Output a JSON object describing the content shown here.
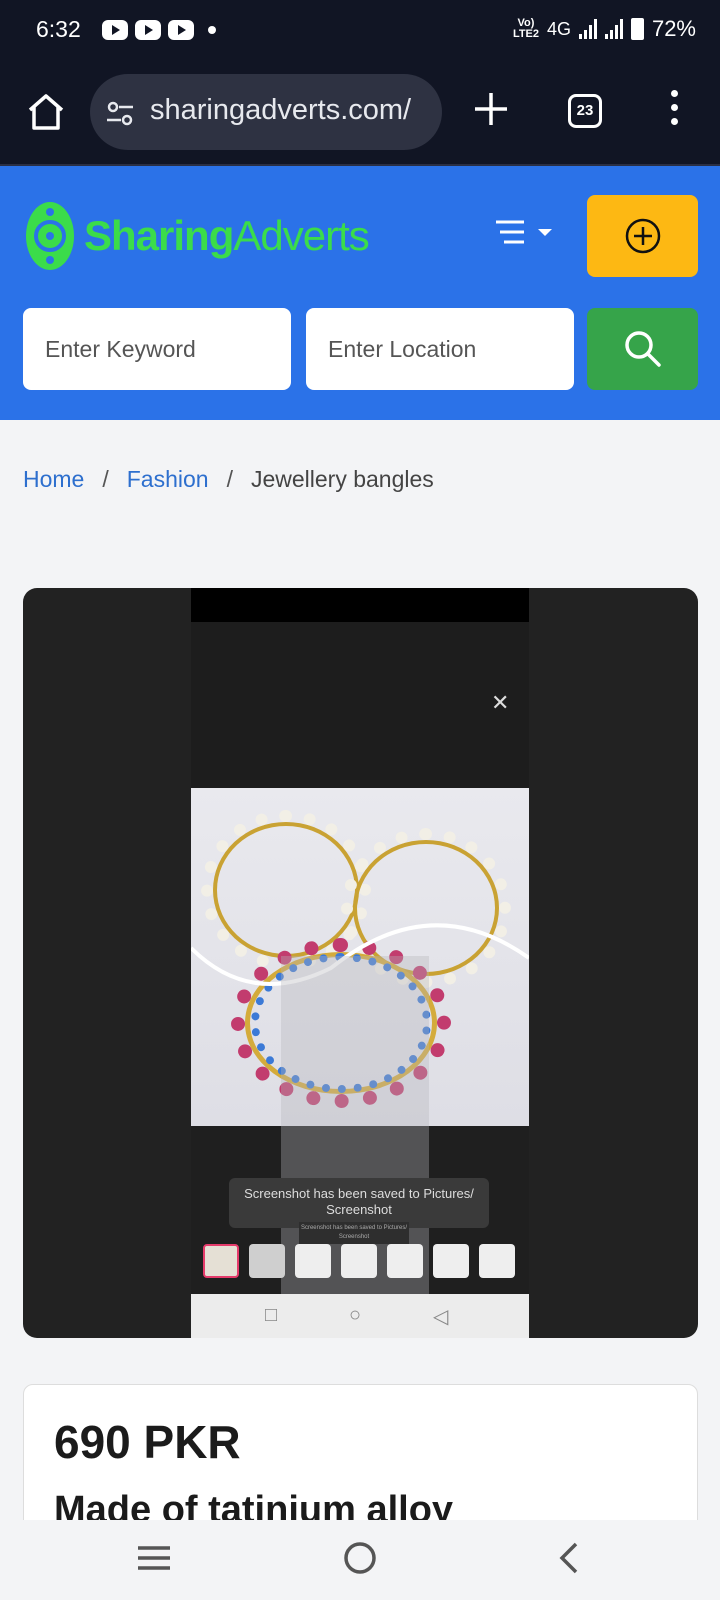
{
  "status_bar": {
    "time": "6:32",
    "network": "4G",
    "volte": "Vo) LTE2",
    "battery": "72%"
  },
  "browser": {
    "url": "sharingadverts.com/",
    "tab_count": "23"
  },
  "site": {
    "logo_part1": "Sharing",
    "logo_part2": "Adverts",
    "keyword_placeholder": "Enter Keyword",
    "location_placeholder": "Enter Location",
    "brand_colors": {
      "header": "#2b72e8",
      "post": "#fdb813",
      "search": "#36a44a",
      "logo": "#3bdc4a"
    }
  },
  "breadcrumb": {
    "home": "Home",
    "category": "Fashion",
    "current": "Jewellery bangles",
    "separator": "/"
  },
  "gallery": {
    "toast": "Screenshot has been saved to  Pictures/ Screenshot",
    "toast_small": "Screenshot has been saved to Pictures/ Screenshot"
  },
  "listing": {
    "price": "690 PKR",
    "title": "Made of tatinium alloy"
  },
  "icons": [
    "home-icon",
    "tune-icon",
    "plus-icon",
    "tabs-icon",
    "more-vert-icon",
    "menu-icon",
    "add-circle-icon",
    "search-icon",
    "close-icon",
    "nav-menu-icon",
    "nav-home-icon",
    "nav-back-icon"
  ]
}
